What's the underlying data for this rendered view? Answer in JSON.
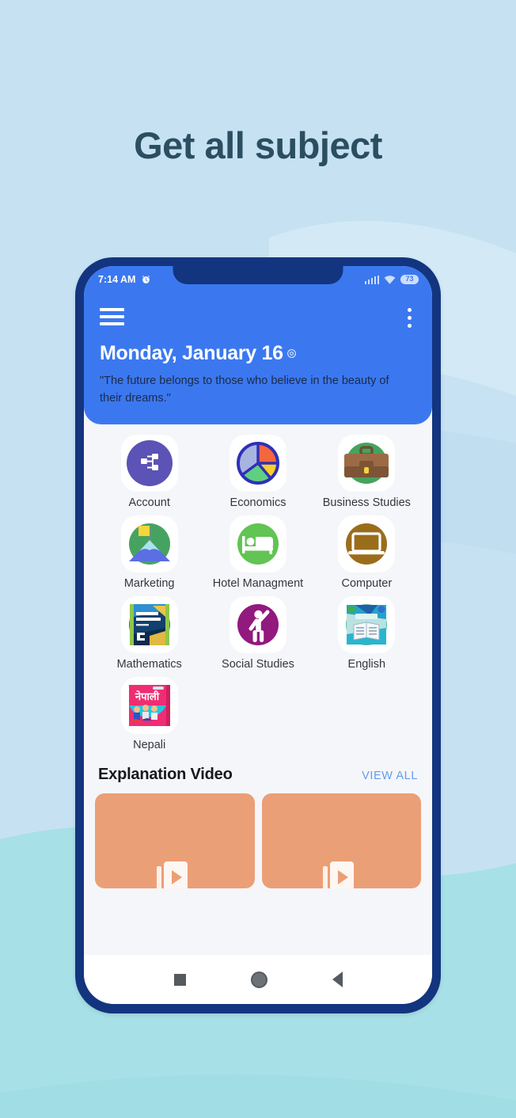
{
  "page": {
    "headline": "Get all subject",
    "background_color": "#c6e2f2",
    "accent_color": "#3b78f0",
    "frame_color": "#13357f"
  },
  "status_bar": {
    "time": "7:14 AM",
    "alarm_icon": "alarm-clock-icon",
    "signal_icon": "cellular-signal-icon",
    "wifi_icon": "wifi-icon",
    "battery": "73"
  },
  "app_bar": {
    "menu_icon": "hamburger-menu-icon",
    "overflow_icon": "kebab-menu-icon",
    "date": "Monday, January 16",
    "date_badge_icon": "copyright-badge-icon",
    "quote": "\"The future belongs to those who believe in the beauty of their dreams.\""
  },
  "subjects": [
    {
      "label": "Account",
      "icon": "hierarchy-icon",
      "color": "#5b53b5"
    },
    {
      "label": "Economics",
      "icon": "pie-chart-icon",
      "color": "#2f2fb8"
    },
    {
      "label": "Business Studies",
      "icon": "briefcase-icon",
      "color": "#46a35f"
    },
    {
      "label": "Marketing",
      "icon": "mountain-flag-icon",
      "color": "#46a35f"
    },
    {
      "label": "Hotel Managment",
      "icon": "bed-icon",
      "color": "#61c453"
    },
    {
      "label": "Computer",
      "icon": "laptop-icon",
      "color": "#9a6d1b"
    },
    {
      "label": "Mathematics",
      "icon": "math-book-icon",
      "color": "#1e6fa8"
    },
    {
      "label": "Social Studies",
      "icon": "person-raised-hand-icon",
      "color": "#92197e"
    },
    {
      "label": "English",
      "icon": "english-book-icon",
      "color": "#58b8a6"
    },
    {
      "label": "Nepali",
      "icon": "nepali-book-icon",
      "color": "#e8266c"
    }
  ],
  "explanation_video": {
    "title": "Explanation Video",
    "view_all_label": "VIEW ALL",
    "card_color": "#eb9f76",
    "cards": [
      {
        "placeholder_icon": "video-placeholder-icon"
      },
      {
        "placeholder_icon": "video-placeholder-icon"
      }
    ]
  },
  "nav_bar": {
    "recents_icon": "square-recents-icon",
    "home_icon": "circle-home-icon",
    "back_icon": "triangle-back-icon"
  }
}
